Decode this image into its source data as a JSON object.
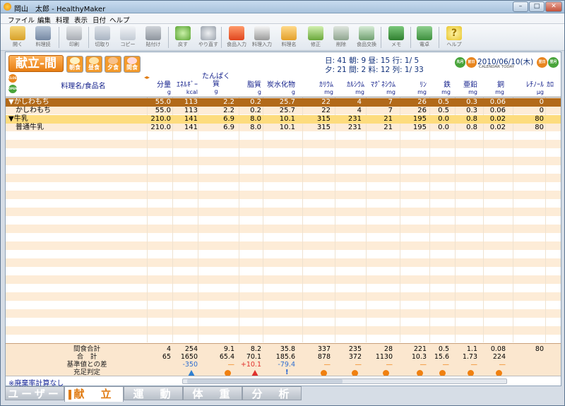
{
  "window": {
    "title": "岡山　太郎 - HealthyMaker"
  },
  "menu": [
    "ファイル",
    "編集",
    "料理",
    "表示",
    "日付",
    "ヘルプ"
  ],
  "toolbar": [
    "開く",
    "料理読",
    "印刷",
    "切取り",
    "コピー",
    "貼付け",
    "戻す",
    "やり直す",
    "食品入力",
    "料理入力",
    "料理名",
    "修正",
    "削除",
    "食品交換",
    "メモ",
    "電卓",
    "ヘルプ"
  ],
  "panel": {
    "title": "献立-間",
    "meals": [
      "朝食",
      "昼食",
      "夕食",
      "間食"
    ],
    "stats": {
      "row1": "日: 41  朝:  9  昼: 15   行:  1/  5",
      "row2": "夕: 21  間:  2  料: 12   列:  1/ 33"
    },
    "date": "2010/06/10(木)",
    "calendar_links": "CALENDAR  TODAY",
    "nav": {
      "prev_month": "先月",
      "prev_day": "前日",
      "next_day": "翌日",
      "next_month": "翌月"
    },
    "close_label": "CLOSE",
    "open_label": "OPEN"
  },
  "columns": {
    "name": "料理名/食品名",
    "nutrients": [
      {
        "label": "分量",
        "unit": "g"
      },
      {
        "label": "ｴﾈﾙｷﾞｰ",
        "unit": "kcal"
      },
      {
        "label": "たんぱく質",
        "unit": "g"
      },
      {
        "label": "脂質",
        "unit": "g"
      },
      {
        "label": "炭水化物",
        "unit": "g"
      },
      {
        "label": "ｶﾘｳﾑ",
        "unit": "mg"
      },
      {
        "label": "ｶﾙｼｳﾑ",
        "unit": "mg"
      },
      {
        "label": "ﾏｸﾞﾈｼｳﾑ",
        "unit": "mg"
      },
      {
        "label": "ﾘﾝ",
        "unit": "mg"
      },
      {
        "label": "鉄",
        "unit": "mg"
      },
      {
        "label": "亜鉛",
        "unit": "mg"
      },
      {
        "label": "銅",
        "unit": "mg"
      },
      {
        "label": "ﾚﾁﾉｰﾙ",
        "unit": "μg"
      },
      {
        "label": "ｶﾛ",
        "unit": ""
      }
    ]
  },
  "rows": [
    {
      "name": "▼かしわもち",
      "kind": "cat1",
      "values": [
        "55.0",
        "113",
        "2.2",
        "0.2",
        "25.7",
        "22",
        "4",
        "7",
        "26",
        "0.5",
        "0.3",
        "0.06",
        "0"
      ]
    },
    {
      "name": "かしわもち",
      "kind": "food",
      "values": [
        "55.0",
        "113",
        "2.2",
        "0.2",
        "25.7",
        "22",
        "4",
        "7",
        "26",
        "0.5",
        "0.3",
        "0.06",
        "0"
      ]
    },
    {
      "name": "▼牛乳",
      "kind": "cat2",
      "values": [
        "210.0",
        "141",
        "6.9",
        "8.0",
        "10.1",
        "315",
        "231",
        "21",
        "195",
        "0.0",
        "0.8",
        "0.02",
        "80"
      ]
    },
    {
      "name": "普通牛乳",
      "kind": "food",
      "values": [
        "210.0",
        "141",
        "6.9",
        "8.0",
        "10.1",
        "315",
        "231",
        "21",
        "195",
        "0.0",
        "0.8",
        "0.02",
        "80"
      ]
    }
  ],
  "summary": {
    "snack_total": {
      "label": "間食合計",
      "values": [
        "4",
        "254",
        "9.1",
        "8.2",
        "35.8",
        "337",
        "235",
        "28",
        "221",
        "0.5",
        "1.1",
        "0.08",
        "80"
      ]
    },
    "total": {
      "label": "合　計",
      "values": [
        "65",
        "1650",
        "65.4",
        "70.1",
        "185.6",
        "878",
        "372",
        "1130",
        "10.3",
        "15.6",
        "1.73",
        "224"
      ]
    },
    "diff": {
      "label": "基準値との差",
      "values": [
        "",
        "-350",
        "—",
        "+10.1",
        "-79.4",
        "—",
        "—",
        "—",
        "—",
        "—",
        "—",
        "—",
        ""
      ]
    },
    "judge": {
      "label": "充足判定",
      "marks": [
        "",
        "up-blue",
        "circle",
        "up-red",
        "bang",
        "circle",
        "circle",
        "circle",
        "circle",
        "circle",
        "circle",
        "circle",
        ""
      ]
    }
  },
  "footer": {
    "waste_note": "※廃棄率計算なし"
  },
  "tabs": [
    "ユーザー",
    "献　立",
    "運　動",
    "体　重",
    "分　析"
  ],
  "active_tab": "献　立",
  "colors": {
    "accent": "#e07b12",
    "cat_row": "#b26a1a",
    "cat_row2": "#fddc7e",
    "stripe": "#fdecd7",
    "header_text": "#111e8a"
  }
}
